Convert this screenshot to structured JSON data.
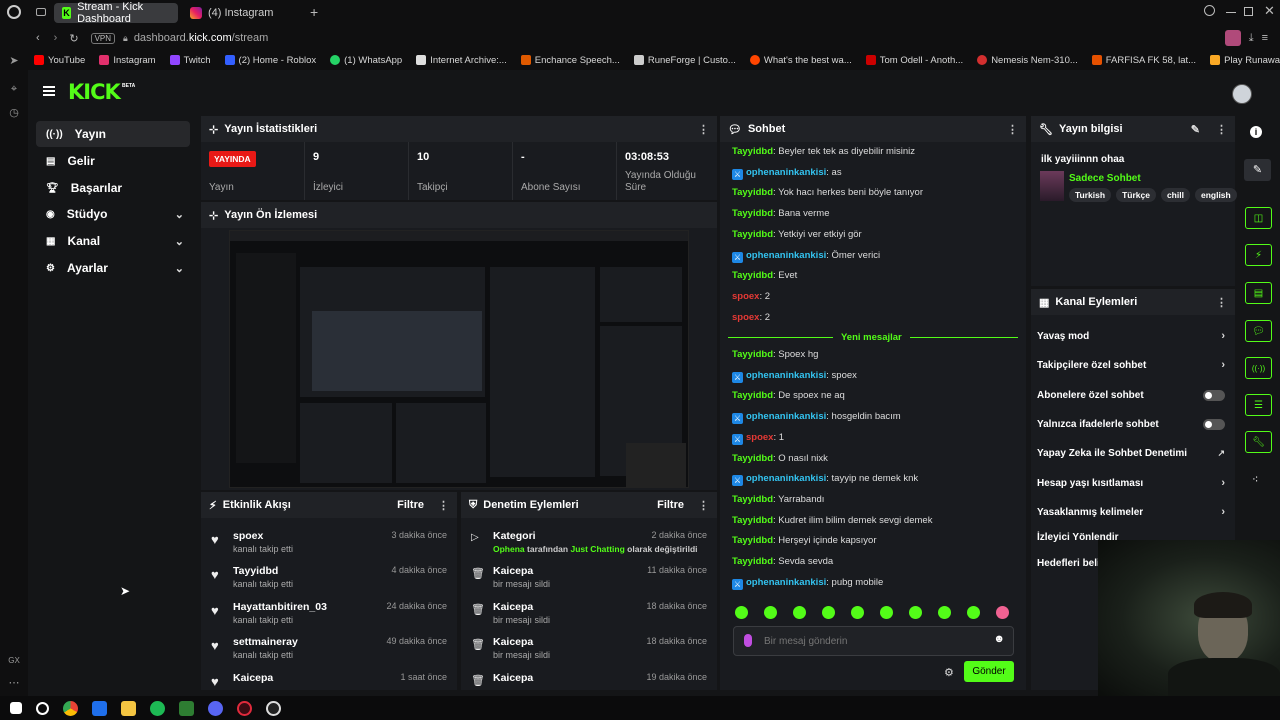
{
  "browser": {
    "tabs": [
      {
        "label": "Stream - Kick Dashboard"
      },
      {
        "label": "(4) Instagram"
      }
    ],
    "url_host": "dashboard.",
    "url_domain": "kick.com",
    "url_path": "/stream",
    "vpn": "VPN",
    "bookmarks": [
      "YouTube",
      "Instagram",
      "Twitch",
      "(2) Home - Roblox",
      "(1) WhatsApp",
      "Internet Archive:...",
      "Enchance Speech...",
      "RuneForge | Custo...",
      "What's the best wa...",
      "Tom Odell - Anoth...",
      "Nemesis Nem-310...",
      "FARFISA FK 58, lat...",
      "Play Runaway (Ka..."
    ]
  },
  "brand": {
    "logo": "KICK",
    "beta": "BETA"
  },
  "nav": [
    {
      "label": "Yayın",
      "icon": "broadcast-icon"
    },
    {
      "label": "Gelir",
      "icon": "chart-icon"
    },
    {
      "label": "Başarılar",
      "icon": "trophy-icon"
    },
    {
      "label": "Stüdyo",
      "icon": "studio-icon"
    },
    {
      "label": "Kanal",
      "icon": "channel-icon"
    },
    {
      "label": "Ayarlar",
      "icon": "gear-icon"
    }
  ],
  "stats": {
    "title": "Yayın İstatistikleri",
    "live_badge": "YAYINDA",
    "live_label": "Yayın",
    "items": [
      {
        "value": "9",
        "label": "İzleyici"
      },
      {
        "value": "10",
        "label": "Takipçi"
      },
      {
        "value": "-",
        "label": "Abone Sayısı"
      },
      {
        "value": "03:08:53",
        "label": "Yayında Olduğu Süre"
      }
    ]
  },
  "preview": {
    "title": "Yayın Ön İzlemesi"
  },
  "activity": {
    "title": "Etkinlik Akışı",
    "filter": "Filtre",
    "items": [
      {
        "name": "spoex",
        "sub": "kanalı takip etti",
        "time": "3 dakika önce"
      },
      {
        "name": "Tayyidbd",
        "sub": "kanalı takip etti",
        "time": "4 dakika önce"
      },
      {
        "name": "Hayattanbitiren_03",
        "sub": "kanalı takip etti",
        "time": "24 dakika önce"
      },
      {
        "name": "settmaineray",
        "sub": "kanalı takip etti",
        "time": "49 dakika önce"
      },
      {
        "name": "Kaicepa",
        "sub": "",
        "time": "1 saat önce"
      }
    ]
  },
  "moderation": {
    "title": "Denetim Eylemleri",
    "filter": "Filtre",
    "items": [
      {
        "name": "Kategori",
        "time": "2 dakika önce",
        "actor": "Ophena",
        "mid": " tarafından ",
        "category": "Just Chatting",
        "end": " olarak değiştirildi"
      },
      {
        "name": "Kaicepa",
        "sub": "bir mesajı sildi",
        "time": "11 dakika önce"
      },
      {
        "name": "Kaicepa",
        "sub": "bir mesajı sildi",
        "time": "18 dakika önce"
      },
      {
        "name": "Kaicepa",
        "sub": "bir mesajı sildi",
        "time": "18 dakika önce"
      },
      {
        "name": "Kaicepa",
        "sub": "",
        "time": "19 dakika önce"
      }
    ]
  },
  "chat": {
    "title": "Sohbet",
    "new_messages": "Yeni mesajlar",
    "messages": [
      {
        "user": "Tayyidbd",
        "text": "Beyler tek tek as diyebilir misiniz",
        "kind": "green"
      },
      {
        "user": "ophenaninkankisi",
        "text": "as",
        "kind": "blue"
      },
      {
        "user": "Tayyidbd",
        "text": "Yok hacı herkes beni böyle tanıyor",
        "kind": "green"
      },
      {
        "user": "Tayyidbd",
        "text": "Bana verme",
        "kind": "green"
      },
      {
        "user": "Tayyidbd",
        "text": "Yetkiyi ver etkiyi gör",
        "kind": "green"
      },
      {
        "user": "ophenaninkankisi",
        "text": "Ömer verici",
        "kind": "blue"
      },
      {
        "user": "Tayyidbd",
        "text": "Evet",
        "kind": "green"
      },
      {
        "user": "spoex",
        "text": "2",
        "kind": "red"
      },
      {
        "user": "spoex",
        "text": "2",
        "kind": "red"
      },
      {
        "user": "Tayyidbd",
        "text": "Spoex hg",
        "kind": "green"
      },
      {
        "user": "ophenaninkankisi",
        "text": "spoex",
        "kind": "blue"
      },
      {
        "user": "Tayyidbd",
        "text": "De spoex ne aq",
        "kind": "green"
      },
      {
        "user": "ophenaninkankisi",
        "text": "hosgeldin bacım",
        "kind": "blue"
      },
      {
        "user": "spoex",
        "text": "1",
        "kind": "redbadge"
      },
      {
        "user": "Tayyidbd",
        "text": "O nasıl nixk",
        "kind": "green"
      },
      {
        "user": "ophenaninkankisi",
        "text": "tayyip ne demek knk",
        "kind": "blue"
      },
      {
        "user": "Tayyidbd",
        "text": "Yarrabandı",
        "kind": "green"
      },
      {
        "user": "Tayyidbd",
        "text": "Kudret ilim bilim demek sevgi demek",
        "kind": "green"
      },
      {
        "user": "Tayyidbd",
        "text": "Herşeyi içinde kapsıyor",
        "kind": "green"
      },
      {
        "user": "Tayyidbd",
        "text": "Sevda sevda",
        "kind": "green"
      },
      {
        "user": "ophenaninkankisi",
        "text": "pubg mobile",
        "kind": "blue"
      }
    ],
    "input_placeholder": "Bir mesaj gönderin",
    "send": "Gönder"
  },
  "info": {
    "title": "Yayın bilgisi",
    "stream_title": "ilk yayiiinnn ohaa",
    "category": "Sadece Sohbet",
    "tags": [
      "Turkish",
      "Türkçe",
      "chill",
      "english"
    ]
  },
  "channel_actions": {
    "title": "Kanal Eylemleri",
    "items": [
      {
        "label": "Yavaş mod",
        "control": "chevron"
      },
      {
        "label": "Takipçilere özel sohbet",
        "control": "chevron"
      },
      {
        "label": "Abonelere özel sohbet",
        "control": "toggle"
      },
      {
        "label": "Yalnızca ifadelerle sohbet",
        "control": "toggle"
      },
      {
        "label": "Yapay Zeka ile Sohbet Denetimi",
        "control": "external"
      },
      {
        "label": "Hesap yaşı kısıtlaması",
        "control": "chevron"
      },
      {
        "label": "Yasaklanmış kelimeler",
        "control": "chevron"
      },
      {
        "label": "İzleyici Yönlendir",
        "control": "none"
      },
      {
        "label": "Hedefleri belirle",
        "control": "none"
      }
    ]
  },
  "colors": {
    "accent": "#53fc18",
    "live": "#e91916",
    "bg": "#141517",
    "panel": "#191b1f"
  }
}
